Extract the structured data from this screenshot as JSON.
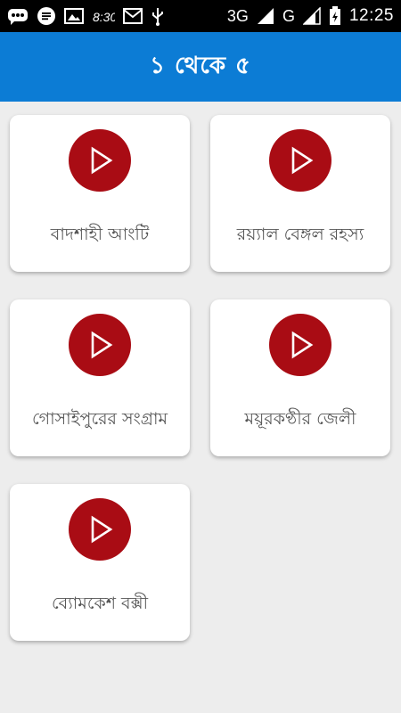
{
  "status_bar": {
    "network_3g": "3G",
    "network_g": "G",
    "time": "12:25",
    "icons": [
      "chat-bubble-icon",
      "message-icon",
      "image-icon",
      "clock-830-icon",
      "gmail-icon",
      "usb-icon",
      "signal-3g-icon",
      "signal-g-icon",
      "battery-charging-icon"
    ]
  },
  "app_bar": {
    "title": "১ থেকে ৫"
  },
  "items": [
    {
      "label": "বাদশাহী আংটি",
      "icon": "play-icon"
    },
    {
      "label": "রয়্যাল বেঙ্গল রহস্য",
      "icon": "play-icon"
    },
    {
      "label": "গোসাইপুরের সংগ্রাম",
      "icon": "play-icon"
    },
    {
      "label": "ময়ূরকণ্ঠীর জেলী",
      "icon": "play-icon"
    },
    {
      "label": "ব্যোমকেশ বক্সী",
      "icon": "play-icon"
    }
  ],
  "colors": {
    "app_bar": "#0c7cd5",
    "play_button": "#a90c14",
    "background": "#ededed",
    "card": "#ffffff"
  }
}
